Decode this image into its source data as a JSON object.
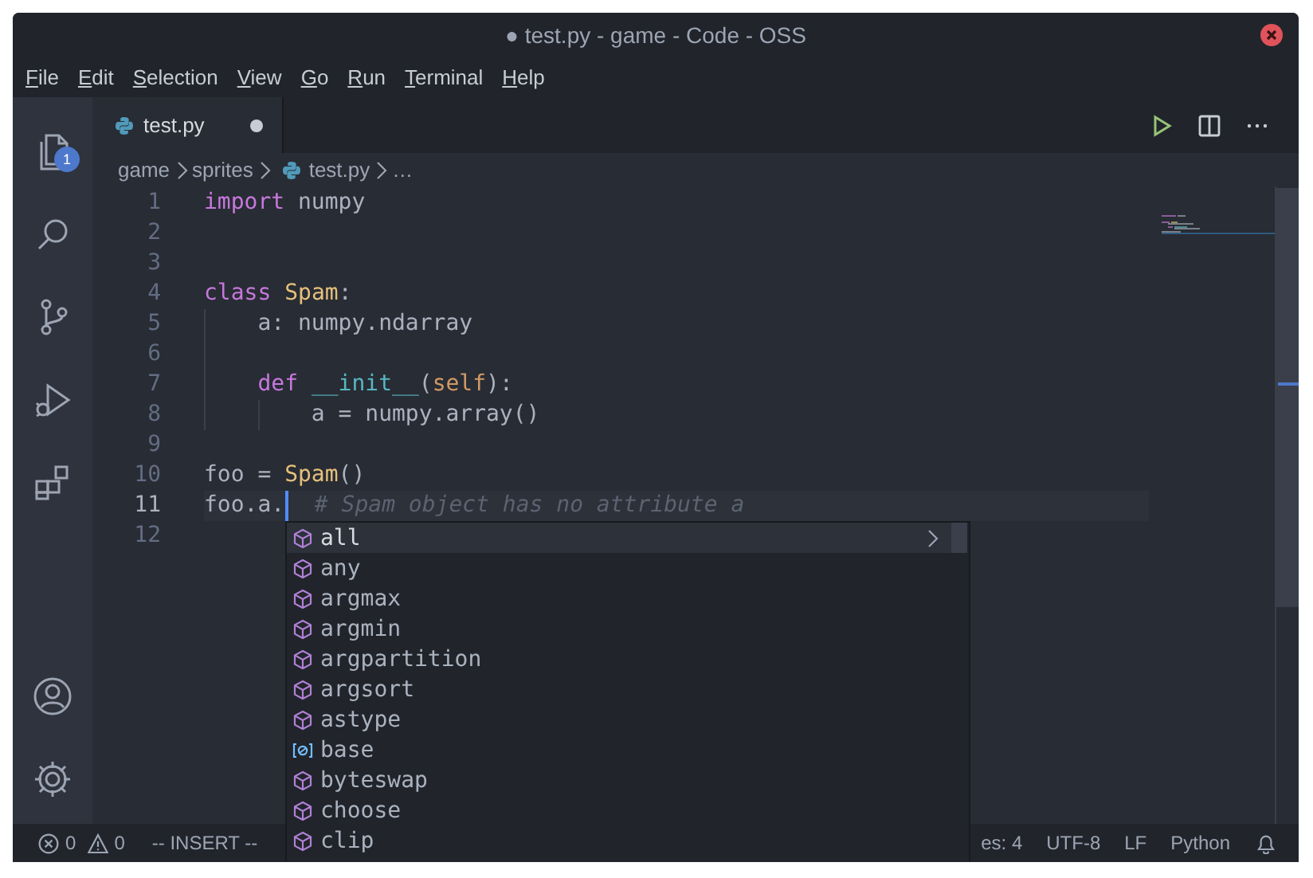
{
  "window": {
    "title": "● test.py - game - Code - OSS"
  },
  "menu": [
    "File",
    "Edit",
    "Selection",
    "View",
    "Go",
    "Run",
    "Terminal",
    "Help"
  ],
  "activity_bar": {
    "badge": "1"
  },
  "tabs": [
    {
      "label": "test.py",
      "selected": true,
      "dirty": true
    }
  ],
  "breadcrumb": [
    {
      "label": "game",
      "kind": "folder"
    },
    {
      "label": "sprites",
      "kind": "folder"
    },
    {
      "label": "test.py",
      "kind": "file"
    },
    {
      "label": "…",
      "kind": "symbol"
    }
  ],
  "editor": {
    "lines": [
      {
        "number": "1",
        "tokens": [
          {
            "kind": "keyword",
            "text": "import"
          },
          {
            "kind": "plain",
            "text": " numpy"
          }
        ]
      },
      {
        "number": "2"
      },
      {
        "number": "3"
      },
      {
        "number": "4",
        "tokens": [
          {
            "kind": "keyword",
            "text": "class"
          },
          {
            "kind": "class",
            "text": " Spam"
          },
          {
            "kind": "plain",
            "text": ":"
          }
        ]
      },
      {
        "number": "5",
        "tokens": [
          {
            "kind": "plain",
            "text": "    a: numpy.ndarray"
          }
        ]
      },
      {
        "number": "6"
      },
      {
        "number": "7",
        "tokens": [
          {
            "kind": "keyword",
            "text": "    def"
          },
          {
            "kind": "function",
            "text": " __init__"
          },
          {
            "kind": "plain",
            "text": "("
          },
          {
            "kind": "param",
            "text": "self"
          },
          {
            "kind": "plain",
            "text": "):"
          }
        ]
      },
      {
        "number": "8",
        "tokens": [
          {
            "kind": "plain",
            "text": "        a = numpy.array()"
          }
        ]
      },
      {
        "number": "9"
      },
      {
        "number": "10",
        "tokens": [
          {
            "kind": "plain",
            "text": "foo = "
          },
          {
            "kind": "class",
            "text": "Spam"
          },
          {
            "kind": "plain",
            "text": "()"
          }
        ]
      },
      {
        "number": "11",
        "current": true,
        "tokens": [
          {
            "kind": "plain",
            "text": "foo.a."
          },
          {
            "kind": "cursor"
          },
          {
            "kind": "ghost",
            "text": "# Spam object has no attribute a"
          }
        ]
      },
      {
        "number": "12"
      }
    ]
  },
  "suggestions": [
    {
      "label": "all",
      "kind": "method",
      "selected": true
    },
    {
      "label": "any",
      "kind": "method",
      "selected": false
    },
    {
      "label": "argmax",
      "kind": "method",
      "selected": false
    },
    {
      "label": "argmin",
      "kind": "method",
      "selected": false
    },
    {
      "label": "argpartition",
      "kind": "method",
      "selected": false
    },
    {
      "label": "argsort",
      "kind": "method",
      "selected": false
    },
    {
      "label": "astype",
      "kind": "method",
      "selected": false
    },
    {
      "label": "base",
      "kind": "field",
      "selected": false
    },
    {
      "label": "byteswap",
      "kind": "method",
      "selected": false
    },
    {
      "label": "choose",
      "kind": "method",
      "selected": false
    },
    {
      "label": "clip",
      "kind": "method",
      "selected": false
    }
  ],
  "status_bar": {
    "errors": "0",
    "warnings": "0",
    "mode": "-- INSERT --",
    "right": [
      "es: 4",
      "UTF-8",
      "LF",
      "Python"
    ]
  }
}
